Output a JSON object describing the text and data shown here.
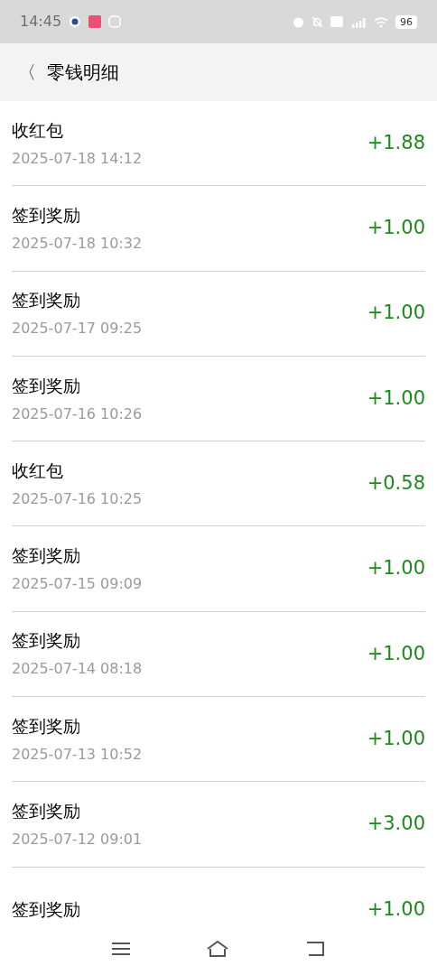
{
  "status_bar": {
    "time": "14:45",
    "battery": "96"
  },
  "header": {
    "back": "〈",
    "title": "零钱明细"
  },
  "transactions": [
    {
      "title": "收红包",
      "date": "2025-07-18 14:12",
      "amount": "+1.88"
    },
    {
      "title": "签到奖励",
      "date": "2025-07-18 10:32",
      "amount": "+1.00"
    },
    {
      "title": "签到奖励",
      "date": "2025-07-17 09:25",
      "amount": "+1.00"
    },
    {
      "title": "签到奖励",
      "date": "2025-07-16 10:26",
      "amount": "+1.00"
    },
    {
      "title": "收红包",
      "date": "2025-07-16 10:25",
      "amount": "+0.58"
    },
    {
      "title": "签到奖励",
      "date": "2025-07-15 09:09",
      "amount": "+1.00"
    },
    {
      "title": "签到奖励",
      "date": "2025-07-14 08:18",
      "amount": "+1.00"
    },
    {
      "title": "签到奖励",
      "date": "2025-07-13 10:52",
      "amount": "+1.00"
    },
    {
      "title": "签到奖励",
      "date": "2025-07-12 09:01",
      "amount": "+3.00"
    },
    {
      "title": "签到奖励",
      "amount": "+1.00"
    }
  ]
}
